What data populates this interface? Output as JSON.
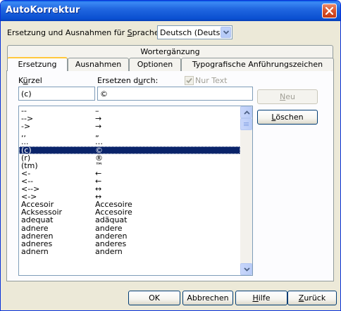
{
  "window": {
    "title": "AutoKorrektur"
  },
  "language": {
    "label_pre": "Ersetzung und Ausnahmen für ",
    "label_ul": "S",
    "label_post": "prache:",
    "value": "Deutsch (Deutschland)"
  },
  "tabs": {
    "top": [
      {
        "label": "Wortergänzung"
      }
    ],
    "bottom": [
      {
        "label": "Ersetzung",
        "active": true
      },
      {
        "label": "Ausnahmen"
      },
      {
        "label": "Optionen"
      },
      {
        "label": "Typografische Anführungszeichen"
      }
    ]
  },
  "fields": {
    "short_label_pre": "K",
    "short_label_ul": "ü",
    "short_label_post": "rzel",
    "short_value": "(c)",
    "replace_label_pre": "Ersetzen d",
    "replace_label_ul": "u",
    "replace_label_post": "rch:",
    "replace_value": "©",
    "text_only_label": "Nur Text",
    "text_only_checked": true
  },
  "list": {
    "rows": [
      {
        "a": "--",
        "b": "–"
      },
      {
        "a": "-->",
        "b": "→"
      },
      {
        "a": "->",
        "b": "→"
      },
      {
        "a": ",,",
        "b": "„"
      },
      {
        "a": "...",
        "b": "…"
      },
      {
        "a": "(c)",
        "b": "©",
        "selected": true
      },
      {
        "a": "(r)",
        "b": "®"
      },
      {
        "a": "(tm)",
        "b": "™"
      },
      {
        "a": "<-",
        "b": "←"
      },
      {
        "a": "<--",
        "b": "←"
      },
      {
        "a": "<-->",
        "b": "↔"
      },
      {
        "a": "<->",
        "b": "↔"
      },
      {
        "a": "Accesoir",
        "b": "Accesoire"
      },
      {
        "a": "Acksessoir",
        "b": "Accesoire"
      },
      {
        "a": "adequat",
        "b": "adäquat"
      },
      {
        "a": "adnere",
        "b": "andere"
      },
      {
        "a": "adneren",
        "b": "anderen"
      },
      {
        "a": "adneres",
        "b": "anderes"
      },
      {
        "a": "adnern",
        "b": "andern"
      }
    ],
    "scroll_up_icon": "chevron-up-icon",
    "scroll_down_icon": "chevron-down-icon"
  },
  "side_buttons": {
    "new_ul": "N",
    "new_post": "eu",
    "new_enabled": false,
    "delete_ul": "L",
    "delete_post": "öschen"
  },
  "footer": {
    "ok": "OK",
    "cancel": "Abbrechen",
    "help_ul": "H",
    "help_post": "ilfe",
    "back_ul": "Z",
    "back_post": "urück"
  },
  "colors": {
    "title_bar": "#0A4FD1",
    "selection": "#0A246A",
    "active_tab_accent": "#FFC83C",
    "close_button": "#D8532B"
  }
}
